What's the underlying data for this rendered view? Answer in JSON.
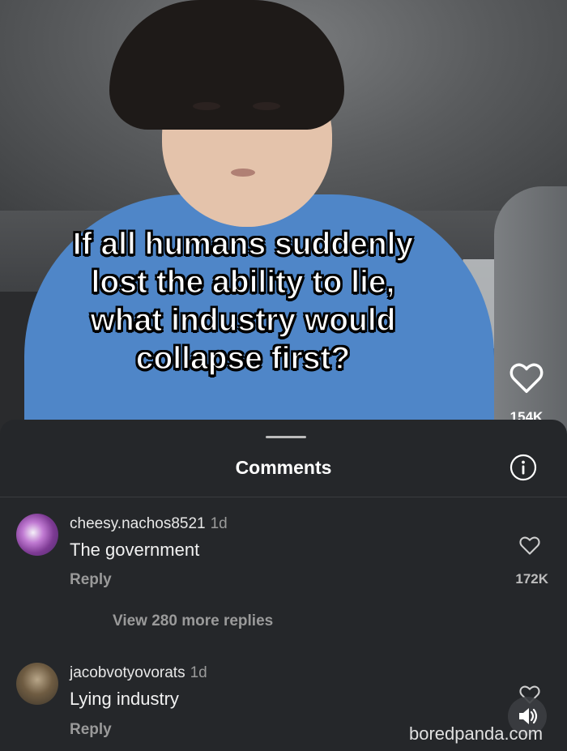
{
  "video": {
    "caption_lines": [
      "If all humans suddenly",
      "lost the ability to lie,",
      "what industry would",
      "collapse first?"
    ],
    "like_count": "154K"
  },
  "comments_panel": {
    "title": "Comments",
    "comments": [
      {
        "username": "cheesy.nachos8521",
        "time": "1d",
        "text": "The government",
        "reply_label": "Reply",
        "like_count": "172K",
        "view_more": "View 280 more replies"
      },
      {
        "username": "jacobvotyovorats",
        "time": "1d",
        "text": "Lying industry",
        "reply_label": "Reply"
      }
    ]
  },
  "watermark": "boredpanda.com",
  "icons": {
    "like": "heart-icon",
    "info": "info-icon",
    "sound": "speaker-icon"
  }
}
